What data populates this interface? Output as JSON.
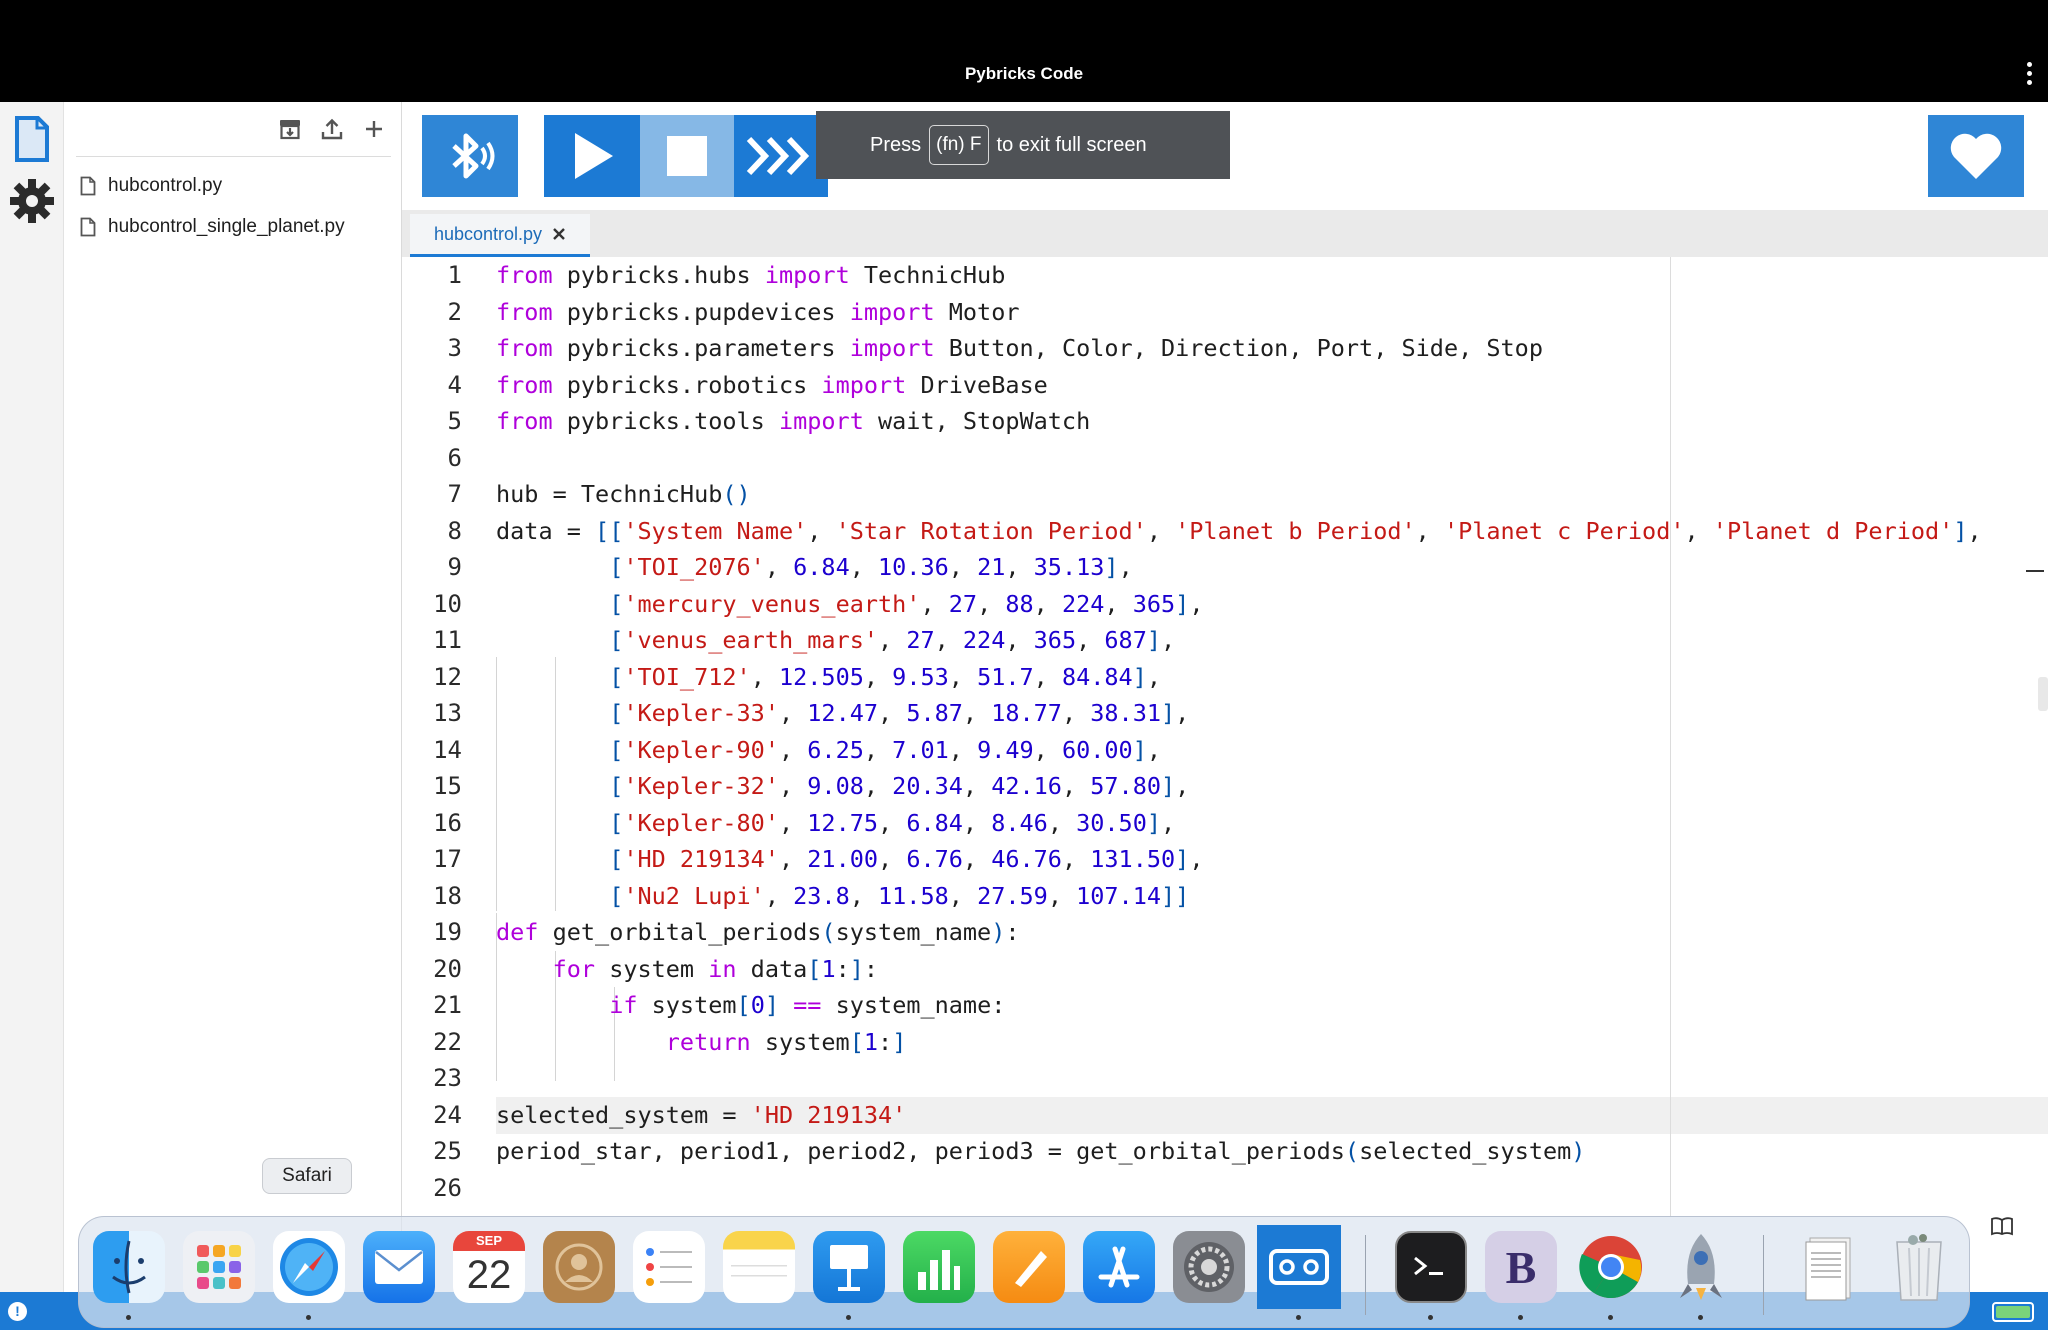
{
  "window": {
    "title": "Pybricks Code"
  },
  "explorer": {
    "files": [
      "hubcontrol.py",
      "hubcontrol_single_planet.py"
    ]
  },
  "toast": {
    "press": "Press",
    "key": "(fn) F",
    "rest": "to exit full screen"
  },
  "tabs": [
    {
      "label": "hubcontrol.py",
      "active": true
    }
  ],
  "editor": {
    "line_numbers": [
      "1",
      "2",
      "3",
      "4",
      "5",
      "6",
      "7",
      "8",
      "9",
      "10",
      "11",
      "12",
      "13",
      "14",
      "15",
      "16",
      "17",
      "18",
      "19",
      "20",
      "21",
      "22",
      "23",
      "24",
      "25",
      "26"
    ],
    "current_line": "24",
    "lines": [
      [
        [
          "kw",
          "from"
        ],
        [
          "t",
          " pybricks.hubs "
        ],
        [
          "kw",
          "import"
        ],
        [
          "t",
          " TechnicHub"
        ]
      ],
      [
        [
          "kw",
          "from"
        ],
        [
          "t",
          " pybricks.pupdevices "
        ],
        [
          "kw",
          "import"
        ],
        [
          "t",
          " Motor"
        ]
      ],
      [
        [
          "kw",
          "from"
        ],
        [
          "t",
          " pybricks.parameters "
        ],
        [
          "kw",
          "import"
        ],
        [
          "t",
          " Button, Color, Direction, Port, Side, Stop"
        ]
      ],
      [
        [
          "kw",
          "from"
        ],
        [
          "t",
          " pybricks.robotics "
        ],
        [
          "kw",
          "import"
        ],
        [
          "t",
          " DriveBase"
        ]
      ],
      [
        [
          "kw",
          "from"
        ],
        [
          "t",
          " pybricks.tools "
        ],
        [
          "kw",
          "import"
        ],
        [
          "t",
          " wait, StopWatch"
        ]
      ],
      [],
      [
        [
          "t",
          "hub = TechnicHub"
        ],
        [
          "br",
          "()"
        ]
      ],
      [
        [
          "t",
          "data = "
        ],
        [
          "br",
          "[["
        ],
        [
          "st",
          "'System Name'"
        ],
        [
          "t",
          ", "
        ],
        [
          "st",
          "'Star Rotation Period'"
        ],
        [
          "t",
          ", "
        ],
        [
          "st",
          "'Planet b Period'"
        ],
        [
          "t",
          ", "
        ],
        [
          "st",
          "'Planet c Period'"
        ],
        [
          "t",
          ", "
        ],
        [
          "st",
          "'Planet d Period'"
        ],
        [
          "br",
          "]"
        ],
        [
          "t",
          ","
        ]
      ],
      [
        [
          "t",
          "        "
        ],
        [
          "br",
          "["
        ],
        [
          "st",
          "'TOI_2076'"
        ],
        [
          "t",
          ", "
        ],
        [
          "nm",
          "6.84"
        ],
        [
          "t",
          ", "
        ],
        [
          "nm",
          "10.36"
        ],
        [
          "t",
          ", "
        ],
        [
          "nm",
          "21"
        ],
        [
          "t",
          ", "
        ],
        [
          "nm",
          "35.13"
        ],
        [
          "br",
          "]"
        ],
        [
          "t",
          ","
        ]
      ],
      [
        [
          "t",
          "        "
        ],
        [
          "br",
          "["
        ],
        [
          "st",
          "'mercury_venus_earth'"
        ],
        [
          "t",
          ", "
        ],
        [
          "nm",
          "27"
        ],
        [
          "t",
          ", "
        ],
        [
          "nm",
          "88"
        ],
        [
          "t",
          ", "
        ],
        [
          "nm",
          "224"
        ],
        [
          "t",
          ", "
        ],
        [
          "nm",
          "365"
        ],
        [
          "br",
          "]"
        ],
        [
          "t",
          ","
        ]
      ],
      [
        [
          "t",
          "        "
        ],
        [
          "br",
          "["
        ],
        [
          "st",
          "'venus_earth_mars'"
        ],
        [
          "t",
          ", "
        ],
        [
          "nm",
          "27"
        ],
        [
          "t",
          ", "
        ],
        [
          "nm",
          "224"
        ],
        [
          "t",
          ", "
        ],
        [
          "nm",
          "365"
        ],
        [
          "t",
          ", "
        ],
        [
          "nm",
          "687"
        ],
        [
          "br",
          "]"
        ],
        [
          "t",
          ","
        ]
      ],
      [
        [
          "t",
          "        "
        ],
        [
          "br",
          "["
        ],
        [
          "st",
          "'TOI_712'"
        ],
        [
          "t",
          ", "
        ],
        [
          "nm",
          "12.505"
        ],
        [
          "t",
          ", "
        ],
        [
          "nm",
          "9.53"
        ],
        [
          "t",
          ", "
        ],
        [
          "nm",
          "51.7"
        ],
        [
          "t",
          ", "
        ],
        [
          "nm",
          "84.84"
        ],
        [
          "br",
          "]"
        ],
        [
          "t",
          ","
        ]
      ],
      [
        [
          "t",
          "        "
        ],
        [
          "br",
          "["
        ],
        [
          "st",
          "'Kepler-33'"
        ],
        [
          "t",
          ", "
        ],
        [
          "nm",
          "12.47"
        ],
        [
          "t",
          ", "
        ],
        [
          "nm",
          "5.87"
        ],
        [
          "t",
          ", "
        ],
        [
          "nm",
          "18.77"
        ],
        [
          "t",
          ", "
        ],
        [
          "nm",
          "38.31"
        ],
        [
          "br",
          "]"
        ],
        [
          "t",
          ","
        ]
      ],
      [
        [
          "t",
          "        "
        ],
        [
          "br",
          "["
        ],
        [
          "st",
          "'Kepler-90'"
        ],
        [
          "t",
          ", "
        ],
        [
          "nm",
          "6.25"
        ],
        [
          "t",
          ", "
        ],
        [
          "nm",
          "7.01"
        ],
        [
          "t",
          ", "
        ],
        [
          "nm",
          "9.49"
        ],
        [
          "t",
          ", "
        ],
        [
          "nm",
          "60.00"
        ],
        [
          "br",
          "]"
        ],
        [
          "t",
          ","
        ]
      ],
      [
        [
          "t",
          "        "
        ],
        [
          "br",
          "["
        ],
        [
          "st",
          "'Kepler-32'"
        ],
        [
          "t",
          ", "
        ],
        [
          "nm",
          "9.08"
        ],
        [
          "t",
          ", "
        ],
        [
          "nm",
          "20.34"
        ],
        [
          "t",
          ", "
        ],
        [
          "nm",
          "42.16"
        ],
        [
          "t",
          ", "
        ],
        [
          "nm",
          "57.80"
        ],
        [
          "br",
          "]"
        ],
        [
          "t",
          ","
        ]
      ],
      [
        [
          "t",
          "        "
        ],
        [
          "br",
          "["
        ],
        [
          "st",
          "'Kepler-80'"
        ],
        [
          "t",
          ", "
        ],
        [
          "nm",
          "12.75"
        ],
        [
          "t",
          ", "
        ],
        [
          "nm",
          "6.84"
        ],
        [
          "t",
          ", "
        ],
        [
          "nm",
          "8.46"
        ],
        [
          "t",
          ", "
        ],
        [
          "nm",
          "30.50"
        ],
        [
          "br",
          "]"
        ],
        [
          "t",
          ","
        ]
      ],
      [
        [
          "t",
          "        "
        ],
        [
          "br",
          "["
        ],
        [
          "st",
          "'HD 219134'"
        ],
        [
          "t",
          ", "
        ],
        [
          "nm",
          "21.00"
        ],
        [
          "t",
          ", "
        ],
        [
          "nm",
          "6.76"
        ],
        [
          "t",
          ", "
        ],
        [
          "nm",
          "46.76"
        ],
        [
          "t",
          ", "
        ],
        [
          "nm",
          "131.50"
        ],
        [
          "br",
          "]"
        ],
        [
          "t",
          ","
        ]
      ],
      [
        [
          "t",
          "        "
        ],
        [
          "br",
          "["
        ],
        [
          "st",
          "'Nu2 Lupi'"
        ],
        [
          "t",
          ", "
        ],
        [
          "nm",
          "23.8"
        ],
        [
          "t",
          ", "
        ],
        [
          "nm",
          "11.58"
        ],
        [
          "t",
          ", "
        ],
        [
          "nm",
          "27.59"
        ],
        [
          "t",
          ", "
        ],
        [
          "nm",
          "107.14"
        ],
        [
          "br",
          "]]"
        ]
      ],
      [
        [
          "kw",
          "def"
        ],
        [
          "t",
          " get_orbital_periods"
        ],
        [
          "br",
          "("
        ],
        [
          "t",
          "system_name"
        ],
        [
          "br",
          ")"
        ],
        [
          "t",
          ":"
        ]
      ],
      [
        [
          "t",
          "    "
        ],
        [
          "kw",
          "for"
        ],
        [
          "t",
          " system "
        ],
        [
          "kw",
          "in"
        ],
        [
          "t",
          " data"
        ],
        [
          "br",
          "["
        ],
        [
          "nm",
          "1"
        ],
        [
          "t",
          ":"
        ],
        [
          "br",
          "]"
        ],
        [
          "t",
          ":"
        ]
      ],
      [
        [
          "t",
          "        "
        ],
        [
          "kw",
          "if"
        ],
        [
          "t",
          " system"
        ],
        [
          "br",
          "["
        ],
        [
          "nm",
          "0"
        ],
        [
          "br",
          "]"
        ],
        [
          "t",
          " "
        ],
        [
          "kw",
          "=="
        ],
        [
          "t",
          " system_name:"
        ]
      ],
      [
        [
          "t",
          "            "
        ],
        [
          "kw",
          "return"
        ],
        [
          "t",
          " system"
        ],
        [
          "br",
          "["
        ],
        [
          "nm",
          "1"
        ],
        [
          "t",
          ":"
        ],
        [
          "br",
          "]"
        ]
      ],
      [],
      [
        [
          "t",
          "selected_system = "
        ],
        [
          "st",
          "'HD 219134'"
        ]
      ],
      [
        [
          "t",
          "period_star, period1, period2, period3 = get_orbital_periods"
        ],
        [
          "br",
          "("
        ],
        [
          "t",
          "selected_system"
        ],
        [
          "br",
          ")"
        ]
      ],
      []
    ]
  },
  "dock": {
    "tooltip": "Safari",
    "calendar": {
      "month": "SEP",
      "day": "22"
    },
    "apps": [
      "Finder",
      "Launchpad",
      "Safari",
      "Mail",
      "Calendar",
      "Contacts",
      "Reminders",
      "Notes",
      "Keynote",
      "Numbers",
      "Pages",
      "App Store",
      "System Settings",
      "Pybricks Code",
      "Terminal",
      "BBEdit",
      "Chrome",
      "Python Launcher",
      "Documents",
      "Trash"
    ]
  }
}
